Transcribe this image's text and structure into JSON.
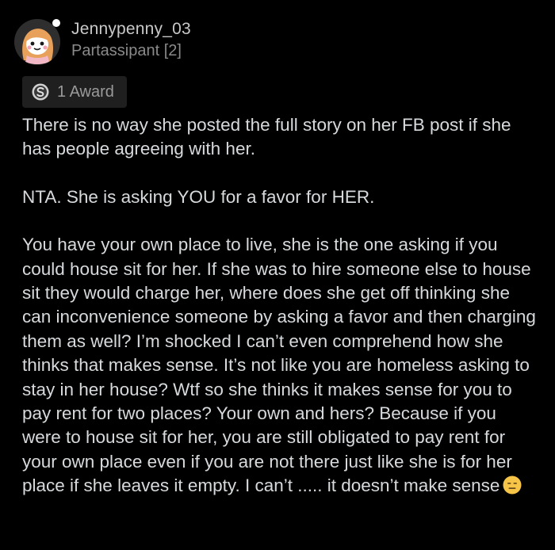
{
  "user": {
    "username": "Jennypenny_03",
    "flair": "Partassipant [2]",
    "avatar_icon": "snoo-avatar-icon"
  },
  "award": {
    "label": "1 Award",
    "icon": "silver-award-icon"
  },
  "comment": {
    "paragraphs": [
      "There is no way she posted the full story on her FB post if she has people agreeing with her.",
      "NTA. She is asking YOU for a favor for HER.",
      "You have your own place to live, she is the one asking if you could house sit for her. If she was to hire someone else to house sit they would charge her, where does she get off thinking she can inconvenience someone by asking a favor and then charging them as well? I’m shocked I can’t even comprehend how she thinks that makes sense. It’s not like you are homeless asking to stay in her house? Wtf so she thinks it makes sense for you to pay rent for two places? Your own and hers? Because if you were to house sit for her, you are still obligated to pay rent for your own place even if you are not there just like she is for her place if she leaves it empty. I can’t ..... it doesn’t make sense"
    ],
    "trailing_emoji": "expressionless-face-emoji"
  },
  "colors": {
    "background": "#000000",
    "text": "#d7dadc",
    "muted": "#8a8a8a",
    "chip": "#1f1f1f"
  }
}
